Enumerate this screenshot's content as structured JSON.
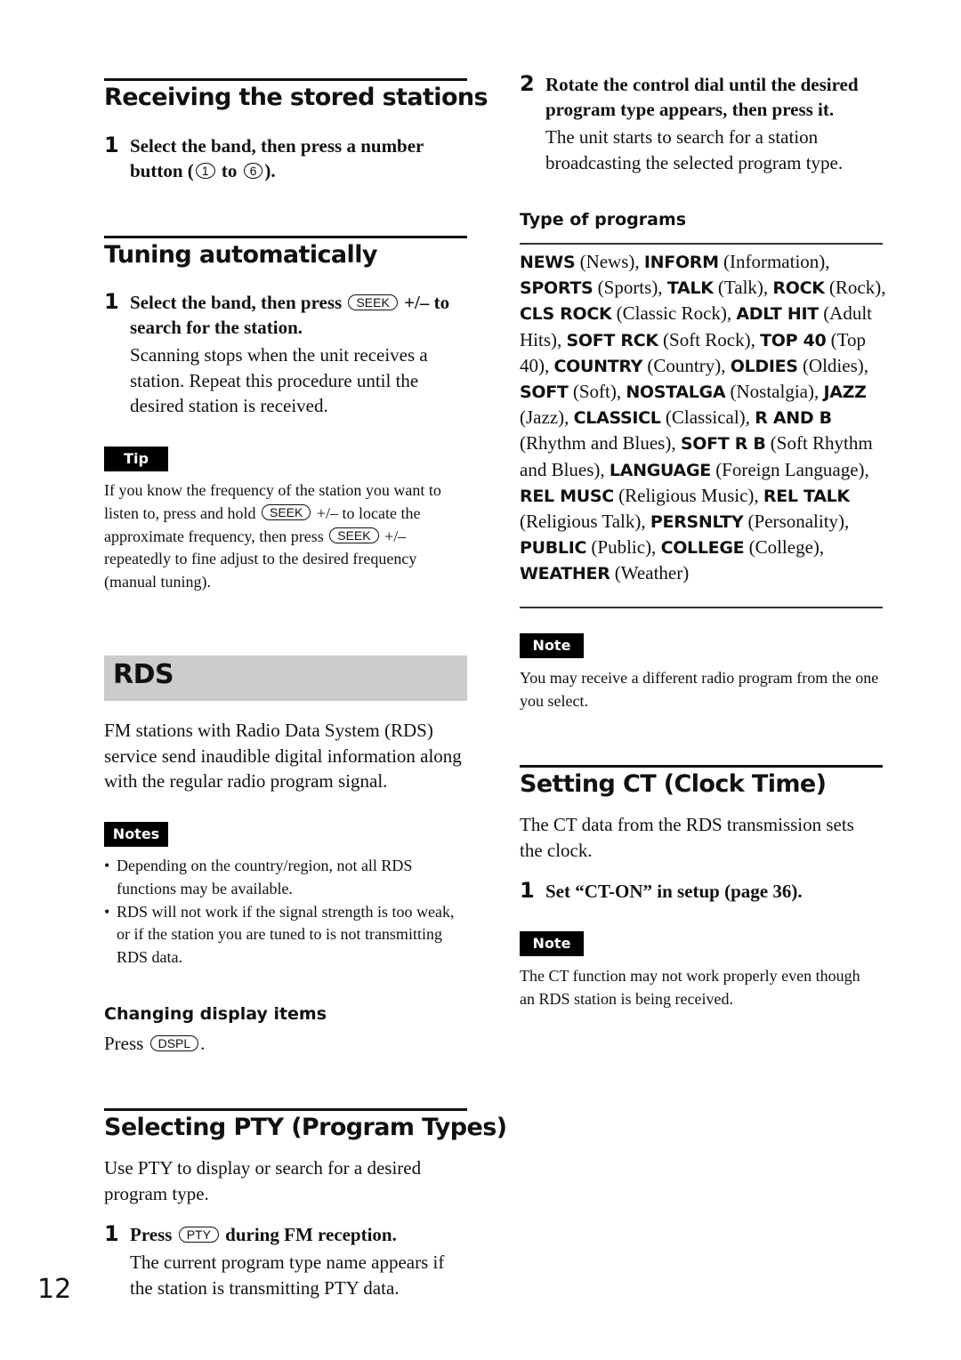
{
  "page_number": "12",
  "receiving": {
    "title": "Receiving the stored stations",
    "step1": {
      "num": "1",
      "pre": "Select the band, then press a number button (",
      "key_a": "1",
      "mid": " to ",
      "key_b": "6",
      "post": ")."
    }
  },
  "tuning": {
    "title": "Tuning automatically",
    "step1": {
      "num": "1",
      "pre": "Select the band, then press ",
      "key": "SEEK",
      "post": " +/– to search for the station."
    },
    "body": "Scanning stops when the unit receives a station. Repeat this procedure until the desired station is received."
  },
  "tip": {
    "label": "Tip",
    "t1": "If you know the frequency of the station you want to listen to, press and hold ",
    "key1": "SEEK",
    "t2": " +/– to locate the approximate frequency, then press ",
    "key2": "SEEK",
    "t3": " +/– repeatedly to fine adjust to the desired frequency (manual tuning)."
  },
  "rds": {
    "title": "RDS",
    "body": "FM stations with Radio Data System (RDS) service send inaudible digital information along with the regular radio program signal.",
    "notes_label": "Notes",
    "notes": [
      "Depending on the country/region, not all RDS functions may be available.",
      "RDS will not work if the signal strength is too weak, or if the station you are tuned to is not transmitting RDS data."
    ],
    "changing_title": "Changing display items",
    "changing_pre": "Press ",
    "changing_key": "DSPL",
    "changing_post": "."
  },
  "pty_section": {
    "title": "Selecting PTY (Program Types)",
    "body": "Use PTY to display or search for a desired program type.",
    "step1": {
      "num": "1",
      "pre": "Press ",
      "key": "PTY",
      "post": " during FM reception."
    },
    "step1_body": "The current program type name appears if the station is transmitting PTY data.",
    "step2": {
      "num": "2",
      "text": "Rotate the control dial until the desired program type appears, then press it."
    },
    "step2_body": "The unit starts to search for a station broadcasting the selected program type."
  },
  "types": {
    "title": "Type of programs",
    "items": [
      {
        "code": "NEWS",
        "name": "News"
      },
      {
        "code": "INFORM",
        "name": "Information"
      },
      {
        "code": "SPORTS",
        "name": "Sports"
      },
      {
        "code": "TALK",
        "name": "Talk"
      },
      {
        "code": "ROCK",
        "name": "Rock"
      },
      {
        "code": "CLS ROCK",
        "name": "Classic Rock"
      },
      {
        "code": "ADLT HIT",
        "name": "Adult Hits"
      },
      {
        "code": "SOFT RCK",
        "name": "Soft Rock"
      },
      {
        "code": "TOP 40",
        "name": "Top 40"
      },
      {
        "code": "COUNTRY",
        "name": "Country"
      },
      {
        "code": "OLDIES",
        "name": "Oldies"
      },
      {
        "code": "SOFT",
        "name": "Soft"
      },
      {
        "code": "NOSTALGA",
        "name": "Nostalgia"
      },
      {
        "code": "JAZZ",
        "name": "Jazz"
      },
      {
        "code": "CLASSICL",
        "name": "Classical"
      },
      {
        "code": "R AND B",
        "name": "Rhythm and Blues"
      },
      {
        "code": "SOFT R B",
        "name": "Soft Rhythm and Blues"
      },
      {
        "code": "LANGUAGE",
        "name": "Foreign Language"
      },
      {
        "code": "REL MUSC",
        "name": "Religious Music"
      },
      {
        "code": "REL TALK",
        "name": "Religious Talk"
      },
      {
        "code": "PERSNLTY",
        "name": "Personality"
      },
      {
        "code": "PUBLIC",
        "name": "Public"
      },
      {
        "code": "COLLEGE",
        "name": "College"
      },
      {
        "code": "WEATHER",
        "name": "Weather"
      }
    ]
  },
  "pty_note": {
    "label": "Note",
    "text": "You may receive a different radio program from the one you select."
  },
  "ct": {
    "title": "Setting CT (Clock Time)",
    "body": "The CT data from the RDS transmission sets the clock.",
    "step1": {
      "num": "1",
      "text": "Set “CT-ON” in setup (page 36)."
    },
    "note_label": "Note",
    "note_text": "The CT function may not work properly even though an RDS station is being received."
  }
}
